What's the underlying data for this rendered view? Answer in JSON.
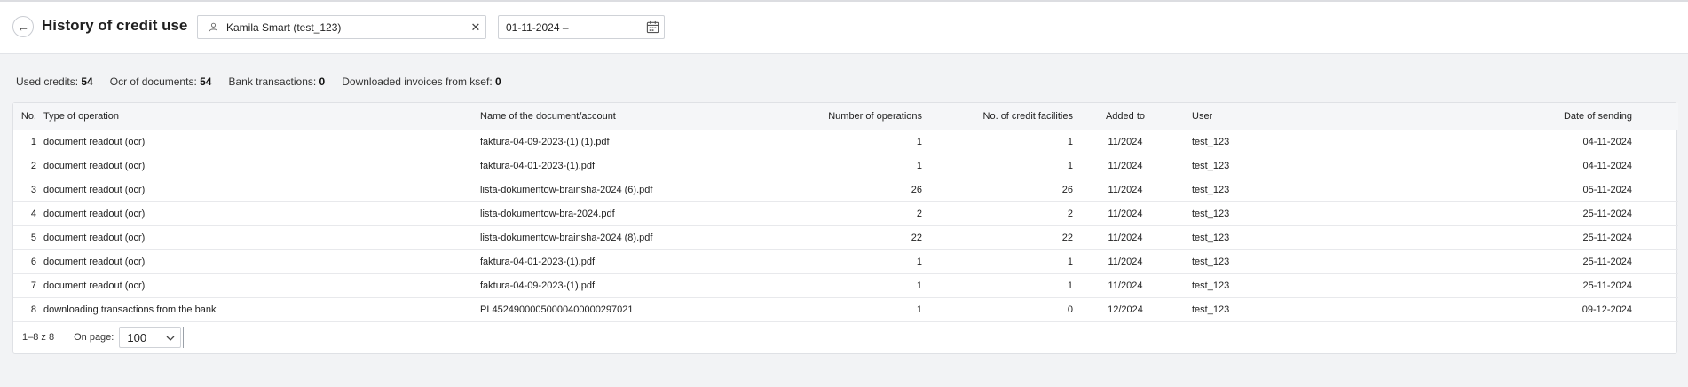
{
  "header": {
    "title": "History of credit use",
    "user_filter": "Kamila Smart (test_123)",
    "date_filter": "01-11-2024 –"
  },
  "icons": {
    "back": "arrow-left-icon",
    "user": "user-icon",
    "clear": "close-icon",
    "calendar": "calendar-icon",
    "dropdown": "chevron-down-icon"
  },
  "summary": {
    "used_credits_label": "Used credits:",
    "used_credits_value": "54",
    "ocr_label": "Ocr of documents:",
    "ocr_value": "54",
    "bank_label": "Bank transactions:",
    "bank_value": "0",
    "ksef_label": "Downloaded invoices from ksef:",
    "ksef_value": "0"
  },
  "table": {
    "columns": {
      "no": "No.",
      "type": "Type of operation",
      "name": "Name of the document/account",
      "ops": "Number of operations",
      "credits": "No. of credit facilities",
      "added": "Added to",
      "user": "User",
      "date": "Date of sending"
    },
    "rows": [
      {
        "no": "1",
        "type": "document readout (ocr)",
        "name": "faktura-04-09-2023-(1) (1).pdf",
        "ops": "1",
        "credits": "1",
        "added": "11/2024",
        "user": "test_123",
        "date": "04-11-2024"
      },
      {
        "no": "2",
        "type": "document readout (ocr)",
        "name": "faktura-04-01-2023-(1).pdf",
        "ops": "1",
        "credits": "1",
        "added": "11/2024",
        "user": "test_123",
        "date": "04-11-2024"
      },
      {
        "no": "3",
        "type": "document readout (ocr)",
        "name": "lista-dokumentow-brainsha-2024 (6).pdf",
        "ops": "26",
        "credits": "26",
        "added": "11/2024",
        "user": "test_123",
        "date": "05-11-2024"
      },
      {
        "no": "4",
        "type": "document readout (ocr)",
        "name": "lista-dokumentow-bra-2024.pdf",
        "ops": "2",
        "credits": "2",
        "added": "11/2024",
        "user": "test_123",
        "date": "25-11-2024"
      },
      {
        "no": "5",
        "type": "document readout (ocr)",
        "name": "lista-dokumentow-brainsha-2024 (8).pdf",
        "ops": "22",
        "credits": "22",
        "added": "11/2024",
        "user": "test_123",
        "date": "25-11-2024"
      },
      {
        "no": "6",
        "type": "document readout (ocr)",
        "name": "faktura-04-01-2023-(1).pdf",
        "ops": "1",
        "credits": "1",
        "added": "11/2024",
        "user": "test_123",
        "date": "25-11-2024"
      },
      {
        "no": "7",
        "type": "document readout (ocr)",
        "name": "faktura-04-09-2023-(1).pdf",
        "ops": "1",
        "credits": "1",
        "added": "11/2024",
        "user": "test_123",
        "date": "25-11-2024"
      },
      {
        "no": "8",
        "type": "downloading transactions from the bank",
        "name": "PL45249000050000400000297021",
        "ops": "1",
        "credits": "0",
        "added": "12/2024",
        "user": "test_123",
        "date": "09-12-2024"
      }
    ]
  },
  "pager": {
    "range": "1–8 z 8",
    "on_page_label": "On page:",
    "page_size": "100"
  }
}
